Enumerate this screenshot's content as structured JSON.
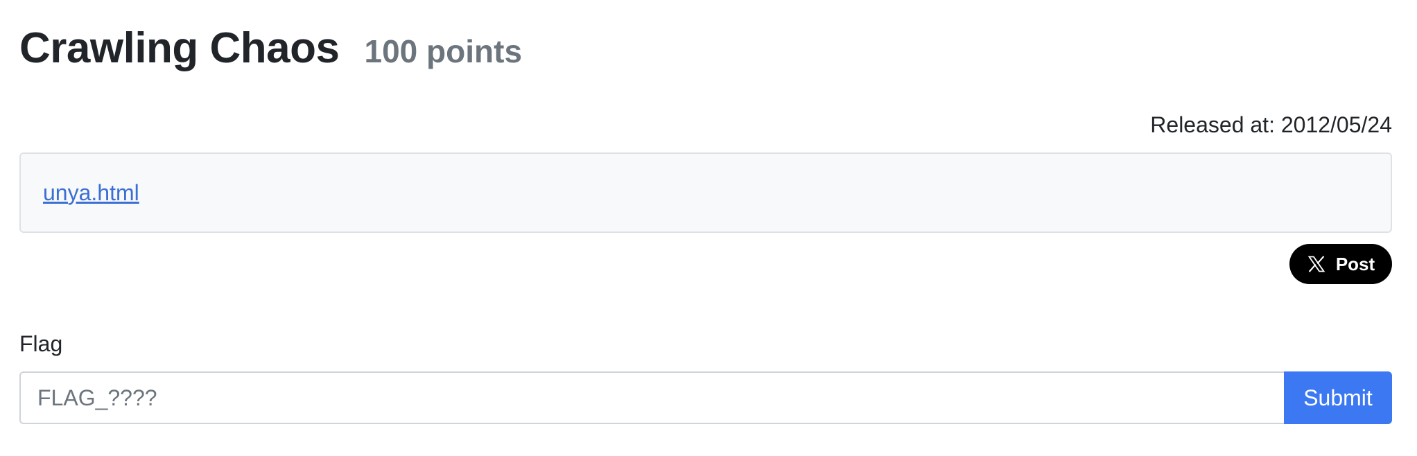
{
  "header": {
    "title": "Crawling Chaos",
    "points": "100 points"
  },
  "meta": {
    "released": "Released at: 2012/05/24"
  },
  "attachments": [
    {
      "label": "unya.html"
    }
  ],
  "share": {
    "post_label": "Post",
    "icon": "x-logo-icon"
  },
  "flag_form": {
    "label": "Flag",
    "placeholder": "FLAG_????",
    "value": "",
    "submit_label": "Submit"
  },
  "colors": {
    "link": "#3b6fd4",
    "submit": "#3b78f2",
    "muted": "#6c757d",
    "box_bg": "#f8f9fa"
  }
}
